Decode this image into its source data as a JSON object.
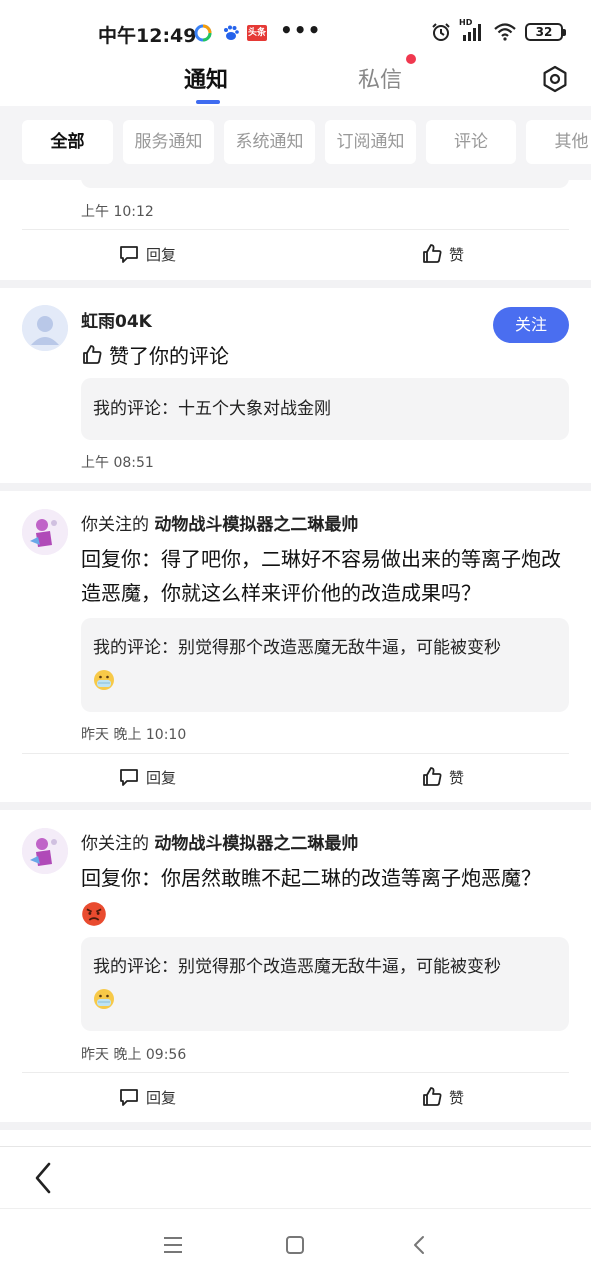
{
  "status_bar": {
    "time": "中午12:49",
    "app_icons": [
      "colorful-ring-icon",
      "baidu-paw-icon",
      "toutiao-icon"
    ],
    "toutiao_label": "头条",
    "more": "•••",
    "battery": "32",
    "hd_label": "HD"
  },
  "header": {
    "tabs": [
      {
        "label": "通知",
        "active": true
      },
      {
        "label": "私信",
        "active": false,
        "has_dot": true
      }
    ],
    "settings_icon": "settings-hex-icon"
  },
  "filters": {
    "chips": [
      "全部",
      "服务通知",
      "系统通知",
      "订阅通知",
      "评论",
      "其他"
    ],
    "active_index": 0
  },
  "feed": {
    "top_partial": {
      "time": "上午 10:12",
      "reply_label": "回复",
      "like_label": "赞"
    },
    "items": [
      {
        "user": "虹雨04K",
        "prefix": "",
        "message": "赞了你的评论",
        "quote": "我的评论：十五个大象对战金刚",
        "time": "上午 08:51",
        "follow_label": "关注"
      },
      {
        "prefix": "你关注的",
        "user": "动物战斗模拟器之二琳最帅",
        "message": "回复你：得了吧你，二琳好不容易做出来的等离子炮改造恶魔，你就这么样来评价他的改造成果吗？",
        "quote": "我的评论：别觉得那个改造恶魔无敌牛逼，可能被变秒",
        "time": "昨天 晚上 10:10",
        "reply_label": "回复",
        "like_label": "赞"
      },
      {
        "prefix": "你关注的",
        "user": "动物战斗模拟器之二琳最帅",
        "message": "回复你：你居然敢瞧不起二琳的改造等离子炮恶魔？",
        "quote": "我的评论：别觉得那个改造恶魔无敌牛逼，可能被变秒",
        "time": "昨天 晚上 09:56",
        "reply_label": "回复",
        "like_label": "赞"
      }
    ]
  },
  "colors": {
    "accent": "#3e6bf0",
    "follow_button": "#4a6ef0",
    "dot": "#f0384f",
    "quote_bg": "#f4f4f5"
  }
}
